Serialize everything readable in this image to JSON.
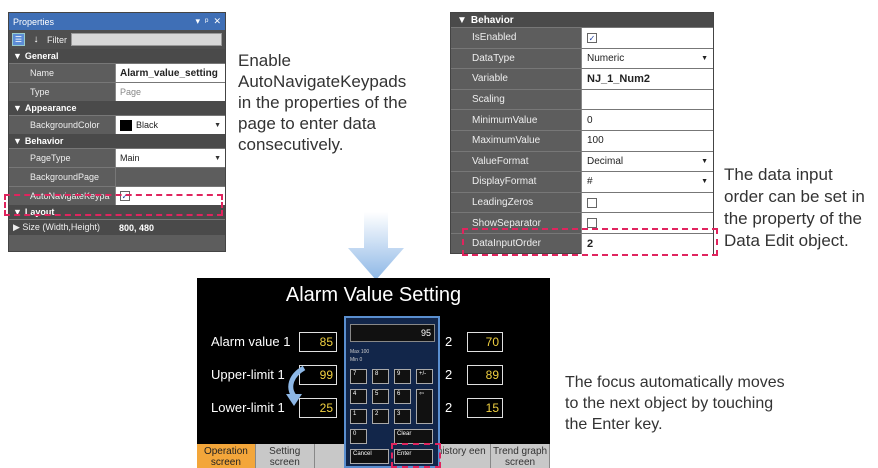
{
  "properties_panel": {
    "title": "Properties",
    "title_controls": [
      "▾",
      "ᵖ",
      "✕"
    ],
    "filter_label": "Filter",
    "sections": {
      "general": "General",
      "appearance": "Appearance",
      "behavior": "Behavior",
      "layout": "Layout"
    },
    "rows": {
      "name": {
        "label": "Name",
        "value": "Alarm_value_setting"
      },
      "type": {
        "label": "Type",
        "value": "Page"
      },
      "background_color": {
        "label": "BackgroundColor",
        "value": "Black"
      },
      "page_type": {
        "label": "PageType",
        "value": "Main"
      },
      "background_page": {
        "label": "BackgroundPage",
        "value": ""
      },
      "auto_navigate": {
        "label": "AutoNavigateKeypa",
        "checked": true
      },
      "size": {
        "label": "Size (Width,Height)",
        "value": "800, 480"
      }
    }
  },
  "caption_left": "Enable AutoNavigateKeypads in the properties of the page to enter data consecutively.",
  "behavior_panel": {
    "section": "Behavior",
    "rows": [
      {
        "label": "IsEnabled",
        "value": "",
        "checkbox": true,
        "checked": true
      },
      {
        "label": "DataType",
        "value": "Numeric",
        "dropdown": true
      },
      {
        "label": "Variable",
        "value": "NJ_1_Num2",
        "bold": true
      },
      {
        "label": "Scaling",
        "value": ""
      },
      {
        "label": "MinimumValue",
        "value": "0"
      },
      {
        "label": "MaximumValue",
        "value": "100"
      },
      {
        "label": "ValueFormat",
        "value": "Decimal",
        "dropdown": true
      },
      {
        "label": "DisplayFormat",
        "value": "#",
        "dropdown": true
      },
      {
        "label": "LeadingZeros",
        "value": "",
        "checkbox": true,
        "checked": false
      },
      {
        "label": "ShowSeparator",
        "value": "",
        "checkbox": true,
        "checked": false
      },
      {
        "label": "DataInputOrder",
        "value": "2",
        "bold": true
      }
    ]
  },
  "caption_right": "The data input order can be set in the property of the Data Edit object.",
  "screen": {
    "title": "Alarm Value Setting",
    "labels": {
      "alarm": "Alarm value 1",
      "upper": "Upper-limit 1",
      "lower": "Lower-limit 1",
      "col2_a": "2",
      "col2_b": "2",
      "col2_c": "2"
    },
    "values": {
      "alarm1": "85",
      "upper1": "99",
      "lower1": "25",
      "alarm2": "70",
      "upper2": "89",
      "lower2": "15"
    },
    "tabs": [
      {
        "label": "Operation screen",
        "active": true
      },
      {
        "label": "Setting screen",
        "active": false
      },
      {
        "label": "",
        "active": false
      },
      {
        "label": "",
        "active": false
      },
      {
        "label": "history een",
        "active": false
      },
      {
        "label": "Trend graph screen",
        "active": false
      }
    ]
  },
  "keypad": {
    "display": "95",
    "max": "Max  100",
    "min": "Min  0",
    "keys": {
      "k7": "7",
      "k8": "8",
      "k9": "9",
      "pm": "+/-",
      "k4": "4",
      "k5": "5",
      "k6": "6",
      "bs": "⇦",
      "k1": "1",
      "k2": "2",
      "k3": "3",
      "k0": "0",
      "clear": "Clear",
      "cancel": "Cancel",
      "enter": "Enter"
    }
  },
  "caption_bottom": "The focus automatically moves to the next object by touching the Enter key.",
  "colors": {
    "accent_dashed": "#e0245e",
    "panel_bg": "#5d5d5d",
    "titlebar": "#3f6fb6",
    "value_yellow": "#f0d040",
    "active_tab": "#f3a63a",
    "arrow": "#8db7e6"
  }
}
